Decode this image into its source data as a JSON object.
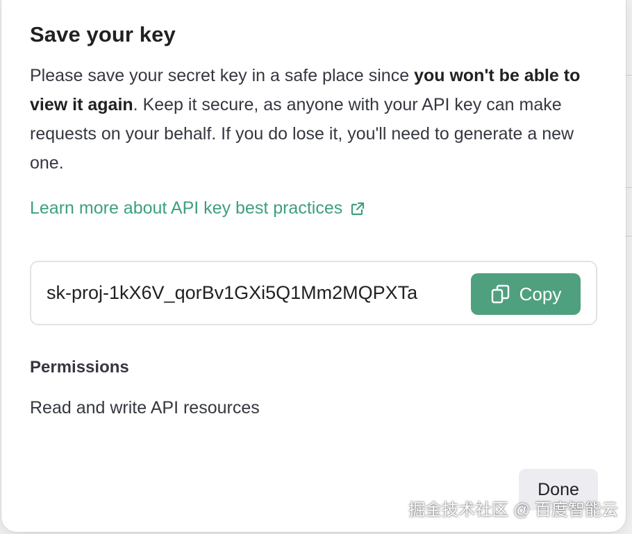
{
  "dialog": {
    "title": "Save your key",
    "body_part1": "Please save your secret key in a safe place since ",
    "body_bold": "you won't be able to view it again",
    "body_part2": ". Keep it secure, as anyone with your API key can make requests on your behalf. If you do lose it, you'll need to generate a new one.",
    "learn_link_label": "Learn more about API key best practices",
    "key_value": "sk-proj-1kX6V_qorBv1GXi5Q1Mm2MQPXTa",
    "copy_label": "Copy",
    "permissions_heading": "Permissions",
    "permissions_value": "Read and write API resources",
    "done_label": "Done"
  },
  "watermark": "掘金技术社区 @ 百度智能云",
  "colors": {
    "accent": "#4fa07e",
    "link": "#3e9f7f",
    "text": "#353740",
    "done_bg": "#ececf1"
  },
  "icons": {
    "external_link": "external-link-icon",
    "copy": "copy-icon"
  }
}
